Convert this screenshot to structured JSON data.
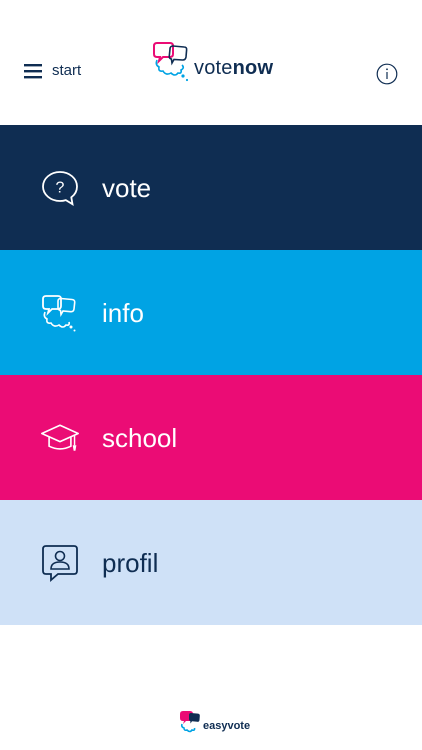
{
  "header": {
    "menu_label": "start",
    "logo": {
      "part1": "vote",
      "part2": "now"
    },
    "info_icon": "info-icon"
  },
  "tiles": [
    {
      "label": "vote",
      "icon": "question-bubble-icon",
      "color": "#0f2d52"
    },
    {
      "label": "info",
      "icon": "chat-bubbles-icon",
      "color": "#00a3e4"
    },
    {
      "label": "school",
      "icon": "graduation-cap-icon",
      "color": "#eb0c75"
    },
    {
      "label": "profil",
      "icon": "profile-bubble-icon",
      "color": "#cfe1f7"
    }
  ],
  "footer": {
    "brand": "easyvote"
  },
  "colors": {
    "navy": "#0f2d52",
    "cyan": "#00a3e4",
    "magenta": "#eb0c75",
    "lightblue": "#cfe1f7"
  }
}
